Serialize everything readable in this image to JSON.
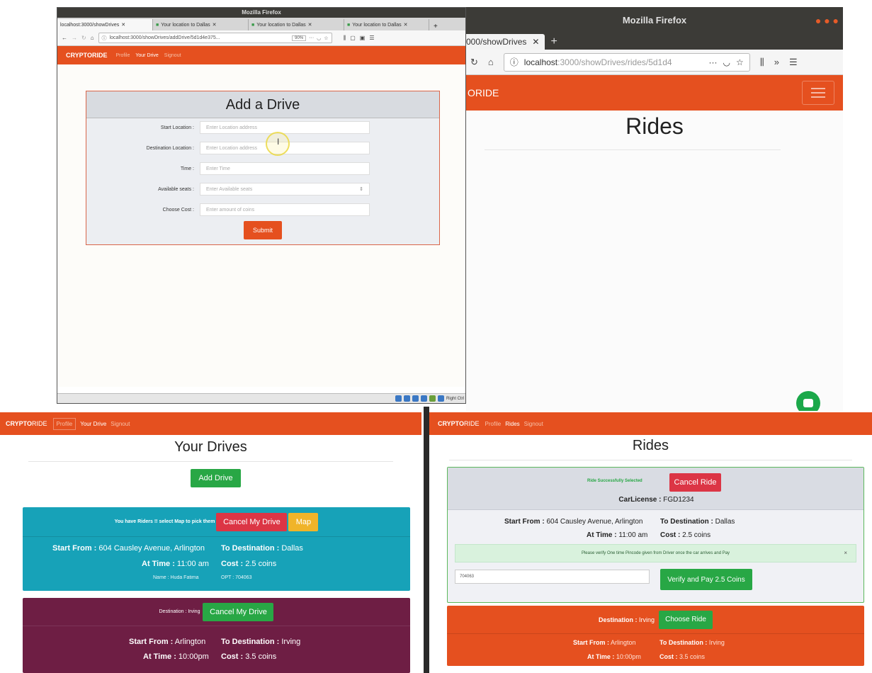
{
  "window1": {
    "title": "Mozilla Firefox",
    "tabs": [
      {
        "label": "localhost:3000/showDrives",
        "active": true
      },
      {
        "label": "Your location to Dallas",
        "active": false
      },
      {
        "label": "Your location to Dallas",
        "active": false
      },
      {
        "label": "Your location to Dallas",
        "active": false
      }
    ],
    "url": "localhost:3000/showDrives/addDrive/5d1d4e375...",
    "zoom": "90%",
    "nav": {
      "brand": "CRYPTORIDE",
      "links": [
        "Profile",
        "Your Drive",
        "Signout"
      ]
    },
    "form": {
      "title": "Add a Drive",
      "fields": [
        {
          "label": "Start Location :",
          "placeholder": "Enter Location address"
        },
        {
          "label": "Destination Location :",
          "placeholder": "Enter Location address"
        },
        {
          "label": "Time :",
          "placeholder": "Enter Time"
        },
        {
          "label": "Available seats :",
          "placeholder": "Enter Available seats"
        },
        {
          "label": "Choose Cost :",
          "placeholder": "Enter amount of coins"
        }
      ],
      "submit": "Submit"
    },
    "status_text": "Right Ctrl"
  },
  "window2": {
    "title": "Mozilla Firefox",
    "tab_label": "000/showDrives",
    "url_host": "localhost",
    "url_path": ":3000/showDrives/rides/5d1d4",
    "brand_partial": "ORIDE",
    "page_title": "Rides"
  },
  "yourDrives": {
    "nav": {
      "brand_a": "CRYPTO",
      "brand_b": "RIDE",
      "links": [
        "Profile",
        "Your Drive",
        "Signout"
      ]
    },
    "title": "Your Drives",
    "add_button": "Add Drive",
    "drive1": {
      "notice": "You have Riders !! select Map to pick them",
      "cancel": "Cancel My Drive",
      "map": "Map",
      "start_label": "Start From :",
      "start_value": "604 Causley Avenue, Arlington",
      "dest_label": "To Destination :",
      "dest_value": "Dallas",
      "time_label": "At Time :",
      "time_value": "11:00 am",
      "cost_label": "Cost :",
      "cost_value": "2.5 coins",
      "name": "Name : Huda Fatima",
      "otp": "OPT : 704063"
    },
    "drive2": {
      "destination": "Destination : Irving",
      "cancel": "Cancel My Drive",
      "start_label": "Start From :",
      "start_value": "Arlington",
      "dest_label": "To Destination :",
      "dest_value": "Irving",
      "time_label": "At Time :",
      "time_value": "10:00pm",
      "cost_label": "Cost :",
      "cost_value": "3.5 coins"
    }
  },
  "rides": {
    "nav": {
      "brand_a": "CRYPTO",
      "brand_b": "RIDE",
      "links": [
        "Profile",
        "Rides",
        "Signout"
      ]
    },
    "title": "Rides",
    "ride1": {
      "success": "Ride Successfully Selected",
      "cancel": "Cancel Ride",
      "carlicense_label": "CarLicense :",
      "carlicense_value": "FGD1234",
      "start_label": "Start From :",
      "start_value": "604 Causley Avenue, Arlington",
      "dest_label": "To Destination :",
      "dest_value": "Dallas",
      "time_label": "At Time :",
      "time_value": "11:00 am",
      "cost_label": "Cost :",
      "cost_value": "2.5 coins",
      "alert": "Please verify One time Pincode given from Driver once the car arrives and Pay",
      "alert_close": "×",
      "pin_value": "704063",
      "verify": "Verify and Pay 2.5 Coins"
    },
    "ride2": {
      "destination_label": "Destination :",
      "destination_value": "Irving",
      "choose": "Choose Ride",
      "start_label": "Start From :",
      "start_value": "Arlington",
      "dest_label": "To Destination :",
      "dest_value": "Irving",
      "time_label": "At Time :",
      "time_value": "10:00pm",
      "cost_label": "Cost :",
      "cost_value": "3.5 coins"
    }
  },
  "colors": {
    "brand_orange": "#e5501f",
    "teal": "#17a2b8",
    "purple": "#6e1e44",
    "green": "#28a745",
    "red": "#dc3545",
    "amber": "#f0b429"
  }
}
